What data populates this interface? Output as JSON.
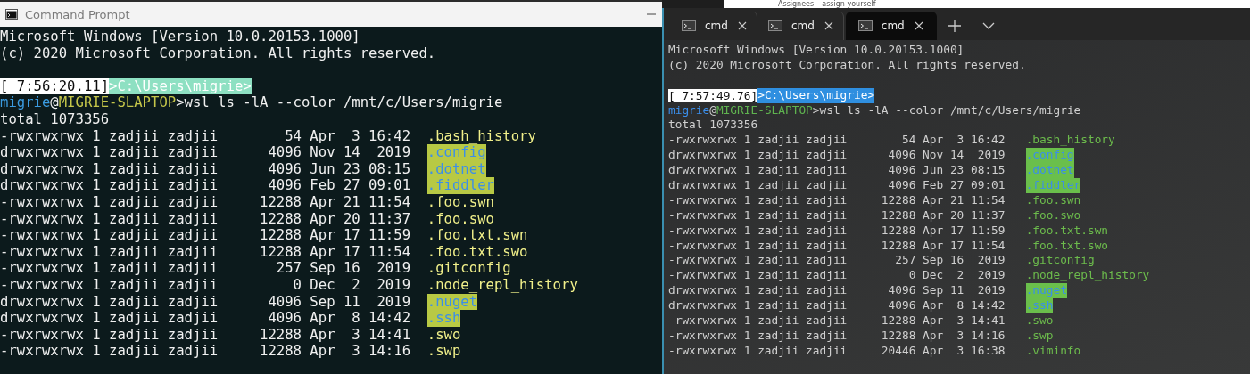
{
  "background_window": {
    "text": "Assignees – assign yourself"
  },
  "windows": [
    {
      "kind": "console",
      "title": "Command Prompt",
      "lines": [
        {
          "kind": "text",
          "text": "Microsoft Windows [Version 10.0.20153.1000]"
        },
        {
          "kind": "text",
          "text": "(c) 2020 Microsoft Corporation. All rights reserved."
        },
        {
          "kind": "blank"
        },
        {
          "kind": "prompt",
          "time": "[ 7:56:20.11]",
          "path": ">C:\\Users\\migrie>"
        },
        {
          "kind": "command",
          "user": "migrie",
          "at": "@",
          "host": "MIGRIE-SLAPTOP",
          "command": ">wsl ls -lA --color /mnt/c/Users/migrie"
        },
        {
          "kind": "text",
          "text": "total 1073356"
        },
        {
          "kind": "entry",
          "info": "-rwxrwxrwx 1 zadjii zadjii        54 Apr  3 16:42",
          "name": ".bash_history",
          "directory": false
        },
        {
          "kind": "entry",
          "info": "drwxrwxrwx 1 zadjii zadjii      4096 Nov 14  2019",
          "name": ".config",
          "directory": true
        },
        {
          "kind": "entry",
          "info": "drwxrwxrwx 1 zadjii zadjii      4096 Jun 23 08:15",
          "name": ".dotnet",
          "directory": true
        },
        {
          "kind": "entry",
          "info": "drwxrwxrwx 1 zadjii zadjii      4096 Feb 27 09:01",
          "name": ".fiddler",
          "directory": true
        },
        {
          "kind": "entry",
          "info": "-rwxrwxrwx 1 zadjii zadjii     12288 Apr 21 11:54",
          "name": ".foo.swn",
          "directory": false
        },
        {
          "kind": "entry",
          "info": "-rwxrwxrwx 1 zadjii zadjii     12288 Apr 20 11:37",
          "name": ".foo.swo",
          "directory": false
        },
        {
          "kind": "entry",
          "info": "-rwxrwxrwx 1 zadjii zadjii     12288 Apr 17 11:59",
          "name": ".foo.txt.swn",
          "directory": false
        },
        {
          "kind": "entry",
          "info": "-rwxrwxrwx 1 zadjii zadjii     12288 Apr 17 11:54",
          "name": ".foo.txt.swo",
          "directory": false
        },
        {
          "kind": "entry",
          "info": "-rwxrwxrwx 1 zadjii zadjii       257 Sep 16  2019",
          "name": ".gitconfig",
          "directory": false
        },
        {
          "kind": "entry",
          "info": "-rwxrwxrwx 1 zadjii zadjii         0 Dec  2  2019",
          "name": ".node_repl_history",
          "directory": false
        },
        {
          "kind": "entry",
          "info": "drwxrwxrwx 1 zadjii zadjii      4096 Sep 11  2019",
          "name": ".nuget",
          "directory": true
        },
        {
          "kind": "entry",
          "info": "drwxrwxrwx 1 zadjii zadjii      4096 Apr  8 14:42",
          "name": ".ssh",
          "directory": true
        },
        {
          "kind": "entry",
          "info": "-rwxrwxrwx 1 zadjii zadjii     12288 Apr  3 14:41",
          "name": ".swo",
          "directory": false
        },
        {
          "kind": "entry",
          "info": "-rwxrwxrwx 1 zadjii zadjii     12288 Apr  3 14:16",
          "name": ".swp",
          "directory": false
        }
      ]
    },
    {
      "kind": "terminal",
      "tabs": [
        {
          "label": "cmd",
          "selected": false
        },
        {
          "label": "cmd",
          "selected": false
        },
        {
          "label": "cmd",
          "selected": true
        }
      ],
      "lines": [
        {
          "kind": "text",
          "text": "Microsoft Windows [Version 10.0.20153.1000]"
        },
        {
          "kind": "text",
          "text": "(c) 2020 Microsoft Corporation. All rights reserved."
        },
        {
          "kind": "blank"
        },
        {
          "kind": "prompt",
          "time": "[ 7:57:49.76]",
          "path": ">C:\\Users\\migrie>"
        },
        {
          "kind": "command",
          "user": "migrie",
          "at": "@",
          "host": "MIGRIE-SLAPTOP",
          "command": ">wsl ls -lA --color /mnt/c/Users/migrie"
        },
        {
          "kind": "text",
          "text": "total 1073356"
        },
        {
          "kind": "entry",
          "info": "-rwxrwxrwx 1 zadjii zadjii        54 Apr  3 16:42",
          "name": ".bash_history",
          "directory": false
        },
        {
          "kind": "entry",
          "info": "drwxrwxrwx 1 zadjii zadjii      4096 Nov 14  2019",
          "name": ".config",
          "directory": true
        },
        {
          "kind": "entry",
          "info": "drwxrwxrwx 1 zadjii zadjii      4096 Jun 23 08:15",
          "name": ".dotnet",
          "directory": true
        },
        {
          "kind": "entry",
          "info": "drwxrwxrwx 1 zadjii zadjii      4096 Feb 27 09:01",
          "name": ".fiddler",
          "directory": true
        },
        {
          "kind": "entry",
          "info": "-rwxrwxrwx 1 zadjii zadjii     12288 Apr 21 11:54",
          "name": ".foo.swn",
          "directory": false
        },
        {
          "kind": "entry",
          "info": "-rwxrwxrwx 1 zadjii zadjii     12288 Apr 20 11:37",
          "name": ".foo.swo",
          "directory": false
        },
        {
          "kind": "entry",
          "info": "-rwxrwxrwx 1 zadjii zadjii     12288 Apr 17 11:59",
          "name": ".foo.txt.swn",
          "directory": false
        },
        {
          "kind": "entry",
          "info": "-rwxrwxrwx 1 zadjii zadjii     12288 Apr 17 11:54",
          "name": ".foo.txt.swo",
          "directory": false
        },
        {
          "kind": "entry",
          "info": "-rwxrwxrwx 1 zadjii zadjii       257 Sep 16  2019",
          "name": ".gitconfig",
          "directory": false
        },
        {
          "kind": "entry",
          "info": "-rwxrwxrwx 1 zadjii zadjii         0 Dec  2  2019",
          "name": ".node_repl_history",
          "directory": false
        },
        {
          "kind": "entry",
          "info": "drwxrwxrwx 1 zadjii zadjii      4096 Sep 11  2019",
          "name": ".nuget",
          "directory": true
        },
        {
          "kind": "entry",
          "info": "drwxrwxrwx 1 zadjii zadjii      4096 Apr  8 14:42",
          "name": ".ssh",
          "directory": true
        },
        {
          "kind": "entry",
          "info": "-rwxrwxrwx 1 zadjii zadjii     12288 Apr  3 14:41",
          "name": ".swo",
          "directory": false
        },
        {
          "kind": "entry",
          "info": "-rwxrwxrwx 1 zadjii zadjii     12288 Apr  3 14:16",
          "name": ".swp",
          "directory": false
        },
        {
          "kind": "entry",
          "info": "-rwxrwxrwx 1 zadjii zadjii     20446 Apr  3 16:38",
          "name": ".viminfo",
          "directory": false
        }
      ]
    }
  ]
}
